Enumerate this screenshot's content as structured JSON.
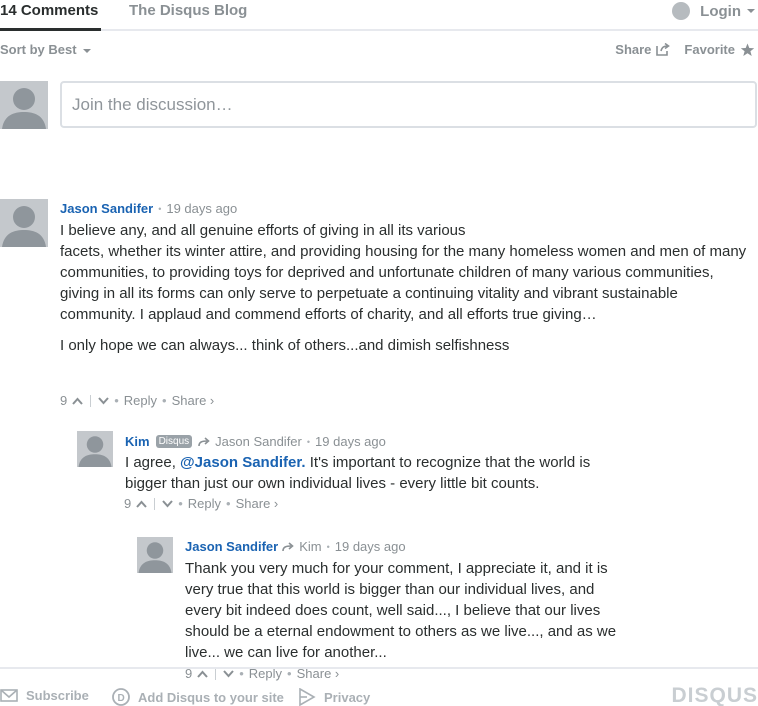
{
  "nav": {
    "comments_tab": "14 Comments",
    "blog_tab": "The Disqus Blog",
    "login": "Login"
  },
  "sortbar": {
    "sort_label": "Sort by Best",
    "share": "Share",
    "favorite": "Favorite"
  },
  "composer": {
    "placeholder": "Join the discussion…"
  },
  "posts": [
    {
      "author": "Jason Sandifer",
      "time": "19 days ago",
      "lines": [
        "I believe any, and all genuine efforts of giving in all its various",
        "facets, whether its winter attire, and providing housing for the many homeless women and men of many communities, to providing toys for deprived and unfortunate children of many various communities,",
        "giving in all its forms can only serve to perpetuate a continuing vitality and vibrant sustainable community. I applaud and commend efforts of charity, and all efforts true giving…",
        "I only hope we can always... think of others...and dimish selfishness"
      ],
      "votes": "9",
      "reply": "Reply",
      "share": "Share ›"
    },
    {
      "author": "Kim",
      "badge": "Disqus",
      "reply_to": "Jason Sandifer",
      "time": "19 days ago",
      "text_before": "I agree, ",
      "mention": "@Jason Sandifer.",
      "text_after": " It's important to recognize that the world is bigger than just our own individual lives - every little bit counts.",
      "votes": "9",
      "reply": "Reply",
      "share": "Share ›"
    },
    {
      "author": "Jason Sandifer",
      "reply_to": "Kim",
      "time": "19 days ago",
      "text": "Thank you very much for your comment, I appreciate it, and it is very true that this world is bigger than our individual lives, and every bit indeed does count, well said..., I believe that our lives should be a eternal endowment to others as we live..., and as we live... we can live for another...",
      "votes": "9",
      "reply": "Reply",
      "share": "Share ›"
    }
  ],
  "footer": {
    "subscribe": "Subscribe",
    "add_disqus": "Add Disqus to your site",
    "privacy": "Privacy",
    "logo": "DISQUS"
  },
  "colors": {
    "accent": "#1a63b2",
    "muted": "#8a9094",
    "border": "#dbdfe4"
  }
}
